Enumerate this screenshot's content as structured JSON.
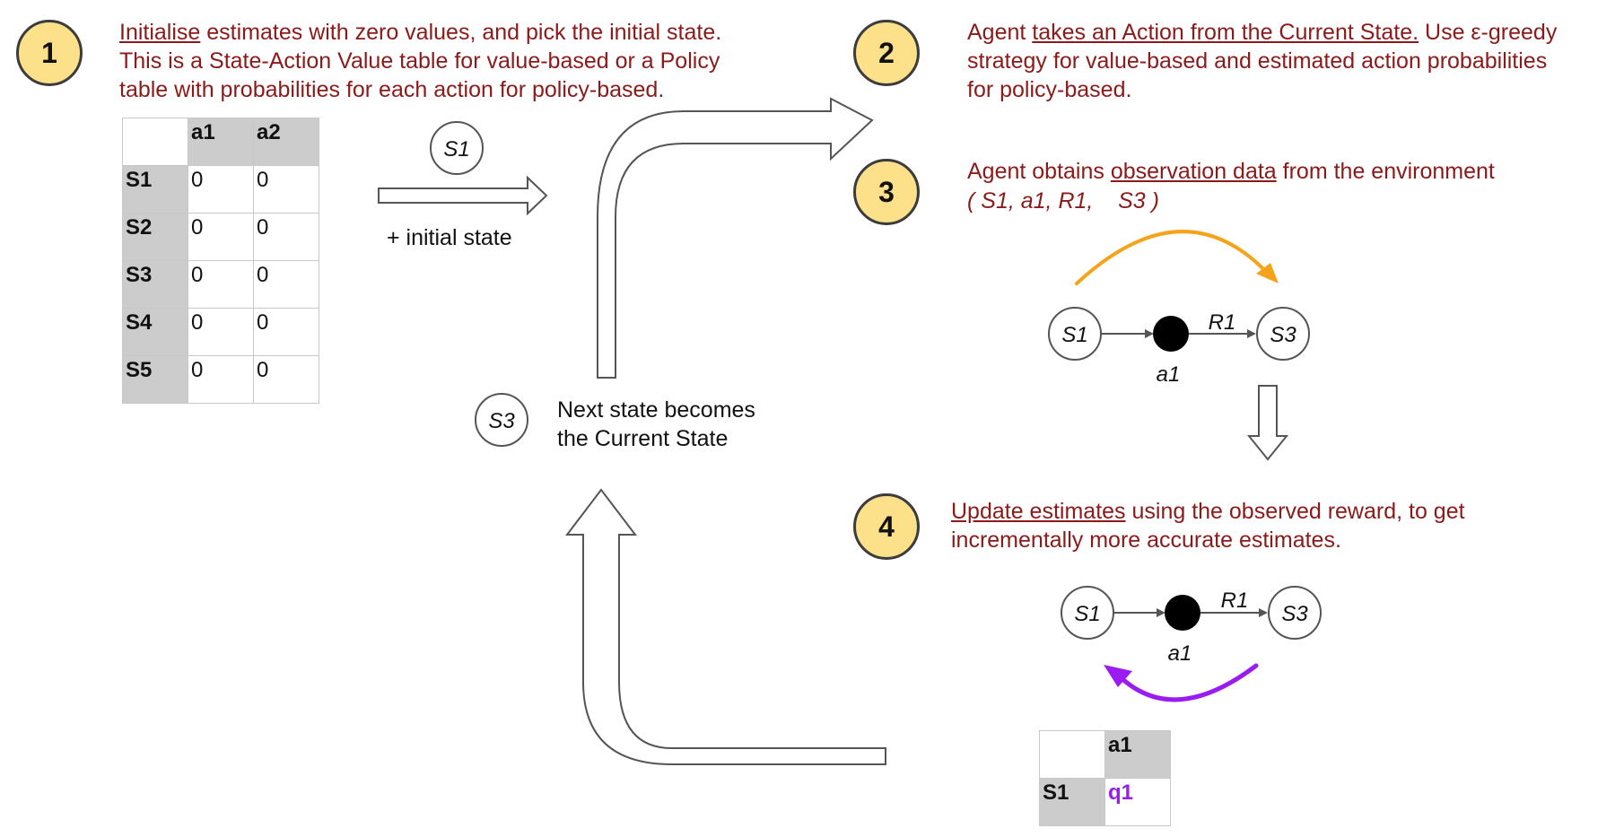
{
  "steps": [
    {
      "number": "1",
      "line1_u": "Initialise",
      "line1_rest": " estimates with zero values, and pick the initial state.",
      "line2": "This is a State-Action Value table for value-based or a Policy",
      "line3": "table with probabilities for each action for policy-based."
    },
    {
      "number": "2",
      "line1_pre": "Agent ",
      "line1_u": "takes an Action from the Current State.",
      "line1_rest": " Use ε-greedy",
      "line2": "strategy for value-based and estimated action probabilities",
      "line3": "for policy-based."
    },
    {
      "number": "3",
      "line1_pre": "Agent obtains ",
      "line1_u": "observation data",
      "line1_rest": " from the environment",
      "tuple": "( S1, a1, R1,    S3 )"
    },
    {
      "number": "4",
      "line1_u": "Update estimates",
      "line1_rest": " using the observed reward, to get",
      "line2": "incrementally more accurate estimates."
    }
  ],
  "initial_table": {
    "columns": [
      "a1",
      "a2"
    ],
    "rows": [
      {
        "state": "S1",
        "values": [
          "0",
          "0"
        ]
      },
      {
        "state": "S2",
        "values": [
          "0",
          "0"
        ]
      },
      {
        "state": "S3",
        "values": [
          "0",
          "0"
        ]
      },
      {
        "state": "S4",
        "values": [
          "0",
          "0"
        ]
      },
      {
        "state": "S5",
        "values": [
          "0",
          "0"
        ]
      }
    ]
  },
  "initial_state": {
    "node": "S1",
    "caption": "+ initial state"
  },
  "next_state": {
    "node": "S3",
    "line1": "Next state becomes",
    "line2": "the Current State"
  },
  "observation_graph": {
    "from": "S1",
    "action": "a1",
    "reward": "R1",
    "to": "S3"
  },
  "update_graph": {
    "from": "S1",
    "action": "a1",
    "reward": "R1",
    "to": "S3"
  },
  "update_table": {
    "column": "a1",
    "row": "S1",
    "value": "q1"
  },
  "colors": {
    "text_red": "#8b1a1a",
    "badge_fill": "#fde08a",
    "orange_arc": "#f5a31a",
    "purple_arc": "#9b1cf2",
    "header_gray": "#cccccc"
  }
}
